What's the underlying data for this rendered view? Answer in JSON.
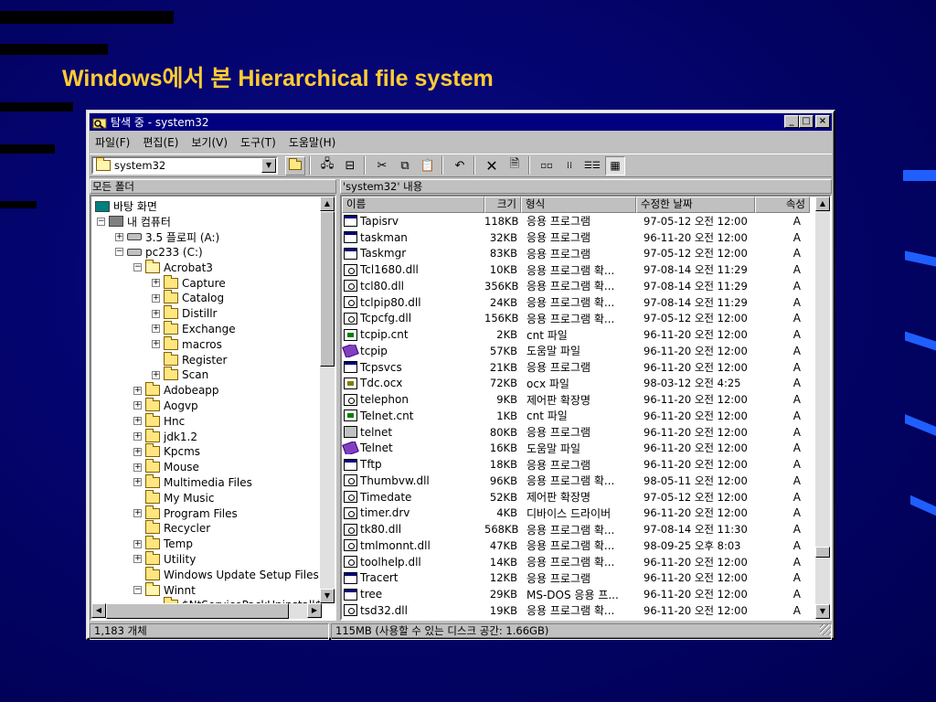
{
  "slide": {
    "title": "Windows에서 본 Hierarchical file system"
  },
  "window": {
    "title": "탐색 중 - system32",
    "menu": [
      "파일(F)",
      "편집(E)",
      "보기(V)",
      "도구(T)",
      "도움말(H)"
    ],
    "address": "system32",
    "left_header": "모든 폴더",
    "right_header": "'system32' 내용",
    "tree": [
      {
        "label": "바탕 화면",
        "level": 0,
        "icon": "desktop-icon",
        "expander": ""
      },
      {
        "label": "내 컴퓨터",
        "level": 1,
        "icon": "computer-icon",
        "expander": "−"
      },
      {
        "label": "3.5 플로피 (A:)",
        "level": 2,
        "icon": "floppy-icon",
        "expander": "+"
      },
      {
        "label": "pc233 (C:)",
        "level": 2,
        "icon": "drive-icon",
        "expander": "−"
      },
      {
        "label": "Acrobat3",
        "level": 3,
        "icon": "folder-open-icon",
        "expander": "−"
      },
      {
        "label": "Capture",
        "level": 4,
        "icon": "folder-icon",
        "expander": "+"
      },
      {
        "label": "Catalog",
        "level": 4,
        "icon": "folder-icon",
        "expander": "+"
      },
      {
        "label": "Distillr",
        "level": 4,
        "icon": "folder-icon",
        "expander": "+"
      },
      {
        "label": "Exchange",
        "level": 4,
        "icon": "folder-icon",
        "expander": "+"
      },
      {
        "label": "macros",
        "level": 4,
        "icon": "folder-icon",
        "expander": "+"
      },
      {
        "label": "Register",
        "level": 4,
        "icon": "folder-icon",
        "expander": ""
      },
      {
        "label": "Scan",
        "level": 4,
        "icon": "folder-icon",
        "expander": "+"
      },
      {
        "label": "Adobeapp",
        "level": 3,
        "icon": "folder-icon",
        "expander": "+"
      },
      {
        "label": "Aogvp",
        "level": 3,
        "icon": "folder-icon",
        "expander": "+"
      },
      {
        "label": "Hnc",
        "level": 3,
        "icon": "folder-icon",
        "expander": "+"
      },
      {
        "label": "jdk1.2",
        "level": 3,
        "icon": "folder-icon",
        "expander": "+"
      },
      {
        "label": "Kpcms",
        "level": 3,
        "icon": "folder-icon",
        "expander": "+"
      },
      {
        "label": "Mouse",
        "level": 3,
        "icon": "folder-icon",
        "expander": "+"
      },
      {
        "label": "Multimedia Files",
        "level": 3,
        "icon": "folder-icon",
        "expander": "+"
      },
      {
        "label": "My Music",
        "level": 3,
        "icon": "folder-icon",
        "expander": ""
      },
      {
        "label": "Program Files",
        "level": 3,
        "icon": "folder-icon",
        "expander": "+"
      },
      {
        "label": "Recycler",
        "level": 3,
        "icon": "folder-icon",
        "expander": ""
      },
      {
        "label": "Temp",
        "level": 3,
        "icon": "folder-icon",
        "expander": "+"
      },
      {
        "label": "Utility",
        "level": 3,
        "icon": "folder-icon",
        "expander": "+"
      },
      {
        "label": "Windows Update Setup Files",
        "level": 3,
        "icon": "folder-icon",
        "expander": ""
      },
      {
        "label": "Winnt",
        "level": 3,
        "icon": "folder-open-icon",
        "expander": "−"
      },
      {
        "label": "$NtServicePackUninstall$",
        "level": 4,
        "icon": "folder-icon",
        "expander": ""
      }
    ],
    "columns": [
      "이름",
      "크기",
      "형식",
      "수정한 날짜",
      "속성"
    ],
    "files": [
      {
        "name": "Tapisrv",
        "size": "118KB",
        "type": "응용 프로그램",
        "date": "97-05-12 오전 12:00",
        "attr": "A",
        "icon": "app"
      },
      {
        "name": "taskman",
        "size": "32KB",
        "type": "응용 프로그램",
        "date": "96-11-20 오전 12:00",
        "attr": "A",
        "icon": "app"
      },
      {
        "name": "Taskmgr",
        "size": "83KB",
        "type": "응용 프로그램",
        "date": "97-05-12 오전 12:00",
        "attr": "A",
        "icon": "app"
      },
      {
        "name": "Tcl1680.dll",
        "size": "10KB",
        "type": "응용 프로그램 확...",
        "date": "97-08-14 오전 11:29",
        "attr": "A",
        "icon": "dll"
      },
      {
        "name": "tcl80.dll",
        "size": "356KB",
        "type": "응용 프로그램 확...",
        "date": "97-08-14 오전 11:29",
        "attr": "A",
        "icon": "dll"
      },
      {
        "name": "tclpip80.dll",
        "size": "24KB",
        "type": "응용 프로그램 확...",
        "date": "97-08-14 오전 11:29",
        "attr": "A",
        "icon": "dll"
      },
      {
        "name": "Tcpcfg.dll",
        "size": "156KB",
        "type": "응용 프로그램 확...",
        "date": "97-05-12 오전 12:00",
        "attr": "A",
        "icon": "dll"
      },
      {
        "name": "tcpip.cnt",
        "size": "2KB",
        "type": "cnt 파일",
        "date": "96-11-20 오전 12:00",
        "attr": "A",
        "icon": "cnt"
      },
      {
        "name": "tcpip",
        "size": "57KB",
        "type": "도움말 파일",
        "date": "96-11-20 오전 12:00",
        "attr": "A",
        "icon": "help"
      },
      {
        "name": "Tcpsvcs",
        "size": "21KB",
        "type": "응용 프로그램",
        "date": "96-11-20 오전 12:00",
        "attr": "A",
        "icon": "app"
      },
      {
        "name": "Tdc.ocx",
        "size": "72KB",
        "type": "ocx 파일",
        "date": "98-03-12 오전 4:25",
        "attr": "A",
        "icon": "ocx"
      },
      {
        "name": "telephon",
        "size": "9KB",
        "type": "제어판 확장명",
        "date": "96-11-20 오전 12:00",
        "attr": "A",
        "icon": "dll"
      },
      {
        "name": "Telnet.cnt",
        "size": "1KB",
        "type": "cnt 파일",
        "date": "96-11-20 오전 12:00",
        "attr": "A",
        "icon": "cnt"
      },
      {
        "name": "telnet",
        "size": "80KB",
        "type": "응용 프로그램",
        "date": "96-11-20 오전 12:00",
        "attr": "A",
        "icon": "pc"
      },
      {
        "name": "Telnet",
        "size": "16KB",
        "type": "도움말 파일",
        "date": "96-11-20 오전 12:00",
        "attr": "A",
        "icon": "help"
      },
      {
        "name": "Tftp",
        "size": "18KB",
        "type": "응용 프로그램",
        "date": "96-11-20 오전 12:00",
        "attr": "A",
        "icon": "app"
      },
      {
        "name": "Thumbvw.dll",
        "size": "96KB",
        "type": "응용 프로그램 확...",
        "date": "98-05-11 오전 12:00",
        "attr": "A",
        "icon": "dll"
      },
      {
        "name": "Timedate",
        "size": "52KB",
        "type": "제어판 확장명",
        "date": "97-05-12 오전 12:00",
        "attr": "A",
        "icon": "dll"
      },
      {
        "name": "timer.drv",
        "size": "4KB",
        "type": "디바이스 드라이버",
        "date": "96-11-20 오전 12:00",
        "attr": "A",
        "icon": "dll"
      },
      {
        "name": "tk80.dll",
        "size": "568KB",
        "type": "응용 프로그램 확...",
        "date": "97-08-14 오전 11:30",
        "attr": "A",
        "icon": "dll"
      },
      {
        "name": "tmlmonnt.dll",
        "size": "47KB",
        "type": "응용 프로그램 확...",
        "date": "98-09-25 오후 8:03",
        "attr": "A",
        "icon": "dll"
      },
      {
        "name": "toolhelp.dll",
        "size": "14KB",
        "type": "응용 프로그램 확...",
        "date": "96-11-20 오전 12:00",
        "attr": "A",
        "icon": "dll"
      },
      {
        "name": "Tracert",
        "size": "12KB",
        "type": "응용 프로그램",
        "date": "96-11-20 오전 12:00",
        "attr": "A",
        "icon": "app"
      },
      {
        "name": "tree",
        "size": "29KB",
        "type": "MS-DOS 응용 프...",
        "date": "96-11-20 오전 12:00",
        "attr": "A",
        "icon": "app"
      },
      {
        "name": "tsd32.dll",
        "size": "19KB",
        "type": "응용 프로그램 확...",
        "date": "96-11-20 오전 12:00",
        "attr": "A",
        "icon": "dll"
      }
    ],
    "status_left": "1,183 개체",
    "status_right": "115MB (사용할 수 있는 디스크 공간: 1.66GB)"
  }
}
